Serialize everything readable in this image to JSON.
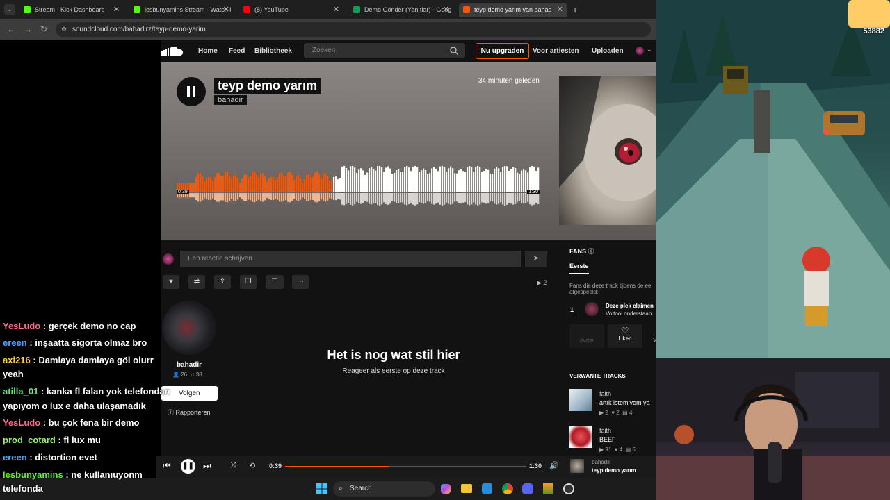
{
  "browser": {
    "tabs": [
      {
        "title": "Stream - Kick Dashboard",
        "favicon_color": "#53fc18"
      },
      {
        "title": "lesbunyamins Stream - Watch l",
        "favicon_color": "#53fc18"
      },
      {
        "title": "(8) YouTube",
        "favicon_color": "#ff0000"
      },
      {
        "title": "Demo Gönder (Yanıtlar) - Goog",
        "favicon_color": "#0f9d58"
      },
      {
        "title": "teyp demo yarım van bahad",
        "favicon_color": "#ff5500"
      }
    ],
    "url": "soundcloud.com/bahadirz/teyp-demo-yarim"
  },
  "soundcloud": {
    "nav": {
      "home": "Home",
      "feed": "Feed",
      "library": "Bibliotheek",
      "search_placeholder": "Zoeken",
      "upgrade": "Nu upgraden",
      "artists": "Voor artiesten",
      "upload": "Uploaden"
    },
    "track": {
      "title": "teyp demo yarım",
      "artist": "bahadir",
      "posted": "34 minuten geleden",
      "elapsed": "0:39",
      "duration": "1:30",
      "progress": 0.43
    },
    "comment_placeholder": "Een reactie schrijven",
    "plays": "2",
    "user": {
      "name": "bahadir",
      "followers": "26",
      "tracks": "38",
      "follow": "Volgen",
      "report": "Rapporteren"
    },
    "empty_title": "Het is nog wat stil hier",
    "empty_sub": "Reageer als eerste op deze track",
    "fans": {
      "title": "FANS",
      "tab": "Eerste",
      "desc1": "Fans die deze track tijdens de ee",
      "desc2": "afgespeeld:",
      "rank": "1",
      "claim": "Deze plek claimen",
      "complete": "Voltooi onderstaan",
      "avatar_label": "Avatar",
      "like_label": "Liken",
      "v": "V"
    },
    "related": {
      "title": "VERWANTE TRACKS",
      "items": [
        {
          "artist": "faith",
          "title": "artık istemiyom ya",
          "plays": "2",
          "likes": "2",
          "comments": "4"
        },
        {
          "artist": "faith",
          "title": "BEEF",
          "plays": "91",
          "likes": "4",
          "comments": "6"
        }
      ]
    },
    "player": {
      "elapsed": "0:39",
      "duration": "1:30",
      "artist": "bahadir",
      "title": "teyp demo yarım"
    }
  },
  "taskbar": {
    "search": "Search"
  },
  "game": {
    "score": "53882"
  },
  "chat": [
    {
      "user": "YesLudo",
      "color": "#ff6b8f",
      "text": " : gerçek demo no cap"
    },
    {
      "user": "ereen",
      "color": "#4aa3ff",
      "text": " : inşaatta sigorta olmaz bro"
    },
    {
      "user": "axi216",
      "color": "#ffd23f",
      "text": " : Damlaya damlaya göl olurr"
    },
    {
      "user": "",
      "color": "#ffffff",
      "text": "yeah"
    },
    {
      "user": "atilla_01",
      "color": "#6be37a",
      "text": " : kanka fl falan yok telefondan"
    },
    {
      "user": "",
      "color": "#ffffff",
      "text": "yapıyom o lux e daha ulaşamadık"
    },
    {
      "user": "YesLudo",
      "color": "#ff6b8f",
      "text": " : bu çok fena bir demo"
    },
    {
      "user": "prod_cotard",
      "color": "#9cf06a",
      "text": " : fl lux mu"
    },
    {
      "user": "ereen",
      "color": "#4aa3ff",
      "text": " : distortion evet"
    },
    {
      "user": "lesbunyamins",
      "color": "#53fc18",
      "text": " : ne kullanıuyonm"
    },
    {
      "user": "",
      "color": "#ffffff",
      "text": "telefonda"
    }
  ]
}
